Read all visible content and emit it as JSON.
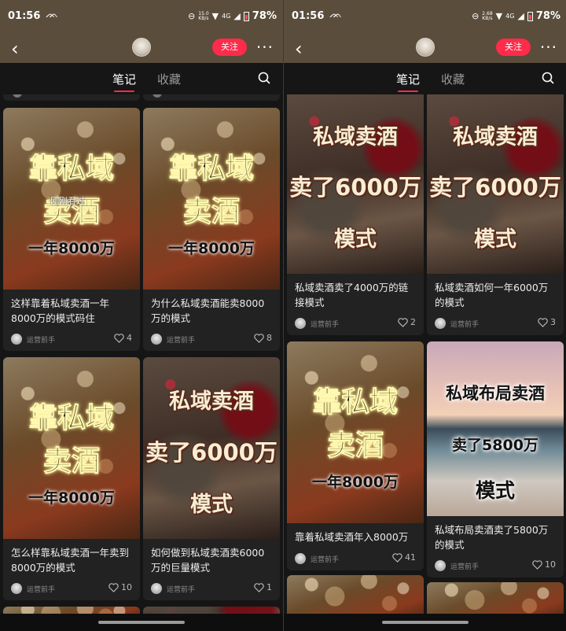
{
  "status_left": {
    "time": "01:56",
    "battery": "78%",
    "net_speed": "15.0",
    "net_unit": "KB/s",
    "signal": "4G"
  },
  "status_right": {
    "time": "01:56",
    "battery": "78%",
    "net_speed": "2.68",
    "net_unit": "KB/s",
    "signal": "4G"
  },
  "header": {
    "follow_label": "关注"
  },
  "tabs": {
    "notes": "笔记",
    "favorites": "收藏"
  },
  "left_cards": [
    {
      "big1": "靠私域",
      "big2": "卖酒",
      "small": "一年8000万",
      "overlay": "刚刚看过",
      "title": "这样靠着私域卖酒一年8000万的模式码住",
      "user": "运营前手",
      "likes": "4"
    },
    {
      "big1": "靠私域",
      "big2": "卖酒",
      "small": "一年8000万",
      "title": "为什么私域卖酒能卖8000万的模式",
      "user": "运营前手",
      "likes": "8"
    },
    {
      "big1": "靠私域",
      "big2": "卖酒",
      "small": "一年8000万",
      "title": "怎么样靠私域卖酒一年卖到8000万的模式",
      "user": "运营前手",
      "likes": "10"
    },
    {
      "line1": "私域卖酒",
      "line2": "卖了6000万",
      "line3": "模式",
      "title": "如何做到私域卖酒卖6000万的巨量模式",
      "user": "运营前手",
      "likes": "1"
    }
  ],
  "right_cards": [
    {
      "line1": "私域卖酒",
      "line2": "卖了6000万",
      "line3": "模式",
      "title": "私域卖酒卖了4000万的链接模式",
      "user": "运营前手",
      "likes": "2"
    },
    {
      "line1": "私域卖酒",
      "line2": "卖了6000万",
      "line3": "模式",
      "title": "私域卖酒如何一年6000万的模式",
      "user": "运营前手",
      "likes": "3"
    },
    {
      "big1": "靠私域",
      "big2": "卖酒",
      "small": "一年8000万",
      "title": "靠着私域卖酒年入8000万",
      "user": "运营前手",
      "likes": "41"
    },
    {
      "line1": "私域布局卖酒",
      "line2": "卖了5800万",
      "line3": "模式",
      "title": "私域布局卖酒卖了5800万的模式",
      "user": "运营前手",
      "likes": "10"
    }
  ],
  "colors": {
    "accent": "#ff2b4a",
    "header_bg": "#5a4d3c",
    "feed_bg": "#151515",
    "card_bg": "#222222"
  },
  "icons": [
    "back-arrow-icon",
    "more-icon",
    "search-icon",
    "heart-icon",
    "wifi-icon",
    "signal-icon",
    "battery-icon",
    "dnd-icon"
  ]
}
